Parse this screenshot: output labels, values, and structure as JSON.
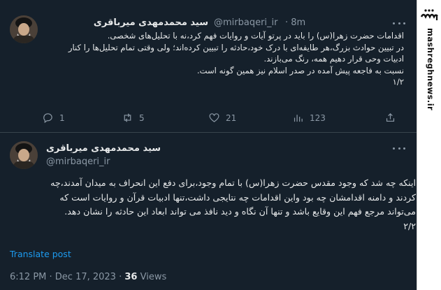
{
  "tweets": [
    {
      "display_name": "سید محمدمهدی میرباقری",
      "handle": "@mirbaqeri_ir",
      "time_ago": "· 8m",
      "body_lines": [
        "اقدامات حضرت زهرا(س) را باید در پرتو آیات و روایات فهم کرد،نه با تحلیل‌های شخصی.",
        "در تبیین حوادث بزرگ،هر طایفه‌ای با درک خود،حادثه را تبیین کرده‌اند؛ ولی وقتی تمام تحلیل‌ها را کنار",
        "ادبیات وحی قرار دهیم همه، رنگ می‌بازند.",
        "نسبت به فاجعه پیش آمده در صدر اسلام نیز همین گونه است.",
        "۱/۲"
      ],
      "stats": {
        "replies": "1",
        "retweets": "5",
        "likes": "21",
        "views": "123"
      }
    },
    {
      "display_name": "سید محمدمهدی میرباقری",
      "handle": "@mirbaqeri_ir",
      "body_lines": [
        "اینکه چه شد که وجود مقدس حضرت زهرا(س) با تمام وجود،برای دفع این انحراف به میدان آمدند،چه",
        "کردند و دامنه اقدامشان چه بود واین اقدامات چه نتایجی داشت،تنها ادبیات قرآن و روایات است که",
        "می‌تواند مرجع فهم این وقایع باشد و تنها آن نگاه و دید نافذ می تواند ابعاد این حادثه را نشان دهد.",
        "۲/۲"
      ],
      "translate_label": "Translate post",
      "timestamp": "6:12 PM · Dec 17, 2023 ·",
      "views_count": "36",
      "views_label": "Views"
    }
  ],
  "watermark": {
    "logo_text": "مشرق",
    "url": "mashreghnews.ir"
  }
}
